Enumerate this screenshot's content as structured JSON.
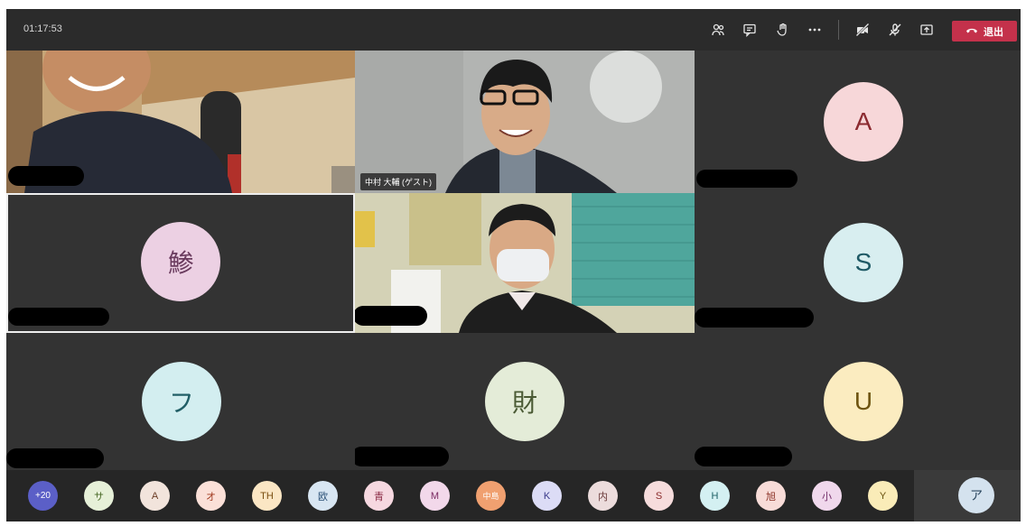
{
  "meeting": {
    "elapsed_time": "01:17:53",
    "leave_label": "退出",
    "toolbar_icons": [
      "participants-icon",
      "chat-icon",
      "raise-hand-icon",
      "more-options-icon",
      "camera-off-icon",
      "mic-off-icon",
      "share-screen-icon",
      "hang-up-icon"
    ]
  },
  "tiles": {
    "guest_name": "中村 大輔 (ゲスト)",
    "avatar_a": "A",
    "avatar_kanji1": "鯵",
    "avatar_s": "S",
    "avatar_fu": "フ",
    "avatar_zai": "財",
    "avatar_u": "U"
  },
  "roster": {
    "overflow": "+20",
    "chips": [
      "サ",
      "A",
      "オ",
      "TH",
      "欧",
      "青",
      "M",
      "中島",
      "K",
      "内",
      "S",
      "H",
      "旭",
      "小",
      "Y"
    ],
    "last": "ア"
  },
  "colors": {
    "leave_button": "#c4314b",
    "tile_background": "#333333"
  }
}
